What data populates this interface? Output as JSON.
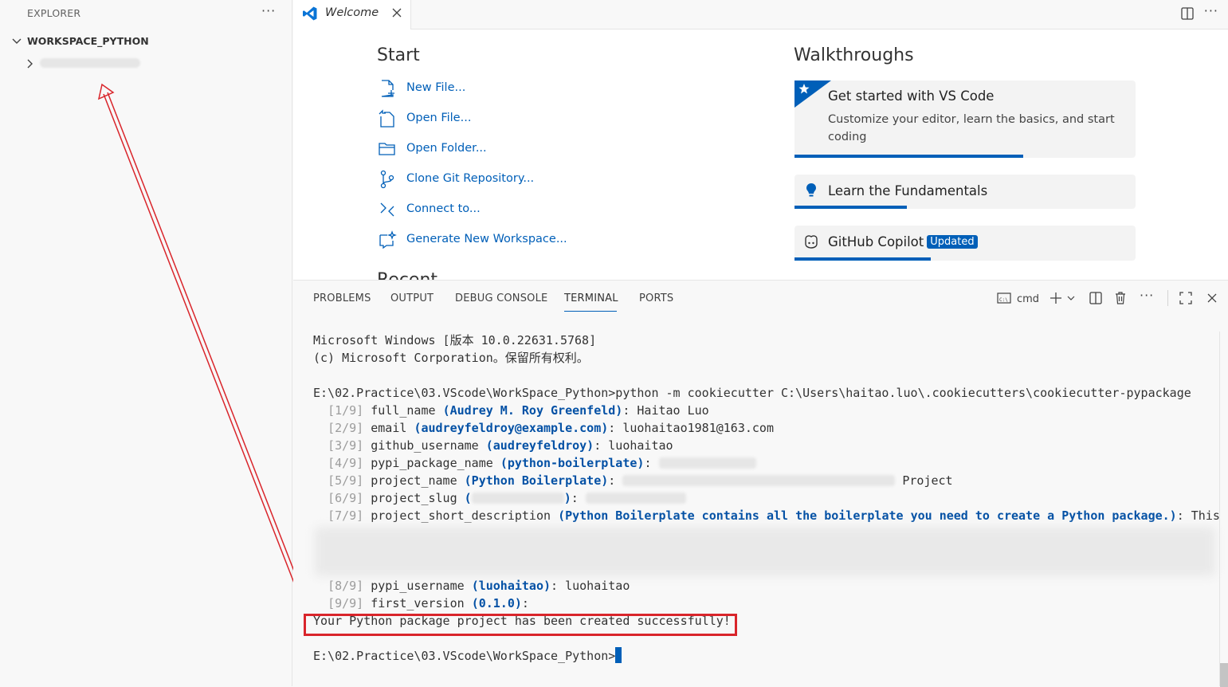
{
  "explorer": {
    "title": "EXPLORER",
    "more": "···",
    "workspace_name": "WORKSPACE_PYTHON"
  },
  "editor": {
    "tab_label": "Welcome",
    "more": "···"
  },
  "welcome": {
    "start_heading": "Start",
    "start_items": [
      {
        "label": "New File...",
        "icon": "new-file-icon"
      },
      {
        "label": "Open File...",
        "icon": "open-file-icon"
      },
      {
        "label": "Open Folder...",
        "icon": "open-folder-icon"
      },
      {
        "label": "Clone Git Repository...",
        "icon": "git-clone-icon"
      },
      {
        "label": "Connect to...",
        "icon": "remote-connect-icon"
      },
      {
        "label": "Generate New Workspace...",
        "icon": "sparkle-workspace-icon"
      }
    ],
    "walkthroughs_heading": "Walkthroughs",
    "walkthroughs": [
      {
        "title": "Get started with VS Code",
        "description": "Customize your editor, learn the basics, and start coding",
        "progress": 0.67
      },
      {
        "title": "Learn the Fundamentals",
        "progress": 0.33
      },
      {
        "title": "GitHub Copilot",
        "badge": "Updated",
        "progress": 0.4
      }
    ]
  },
  "panel": {
    "tabs": [
      "PROBLEMS",
      "OUTPUT",
      "DEBUG CONSOLE",
      "TERMINAL",
      "PORTS"
    ],
    "active_tab": "TERMINAL",
    "shell_label": "cmd",
    "more": "···"
  },
  "terminal": {
    "header1": "Microsoft Windows [版本 10.0.22631.5768]",
    "header2": "(c) Microsoft Corporation。保留所有权利。",
    "command": "E:\\02.Practice\\03.VScode\\WorkSpace_Python>python -m cookiecutter C:\\Users\\haitao.luo\\.cookiecutters\\cookiecutter-pypackage",
    "prompts": [
      {
        "num": "[1/9]",
        "key": "full_name",
        "default": "(Audrey M. Roy Greenfeld)",
        "answer": "Haitao Luo"
      },
      {
        "num": "[2/9]",
        "key": "email",
        "default": "(audreyfeldroy@example.com)",
        "answer": "luohaitao1981@163.com"
      },
      {
        "num": "[3/9]",
        "key": "github_username",
        "default": "(audreyfeldroy)",
        "answer": "luohaitao"
      },
      {
        "num": "[4/9]",
        "key": "pypi_package_name",
        "default": "(python-boilerplate)",
        "answer": ""
      },
      {
        "num": "[5/9]",
        "key": "project_name",
        "default": "(Python Boilerplate)",
        "answer": "Project"
      },
      {
        "num": "[6/9]",
        "key": "project_slug",
        "default": "(",
        "default_end": ")",
        "answer": ""
      },
      {
        "num": "[7/9]",
        "key": "project_short_description",
        "default": "(Python Boilerplate contains all the boilerplate you need to create a Python package.)",
        "answer": "This"
      },
      {
        "num": "[8/9]",
        "key": "pypi_username",
        "default": "(luohaitao)",
        "answer": "luohaitao"
      },
      {
        "num": "[9/9]",
        "key": "first_version",
        "default": "(0.1.0)",
        "answer": ""
      }
    ],
    "success": "Your Python package project has been created successfully!",
    "final_prompt": "E:\\02.Practice\\03.VScode\\WorkSpace_Python>"
  }
}
